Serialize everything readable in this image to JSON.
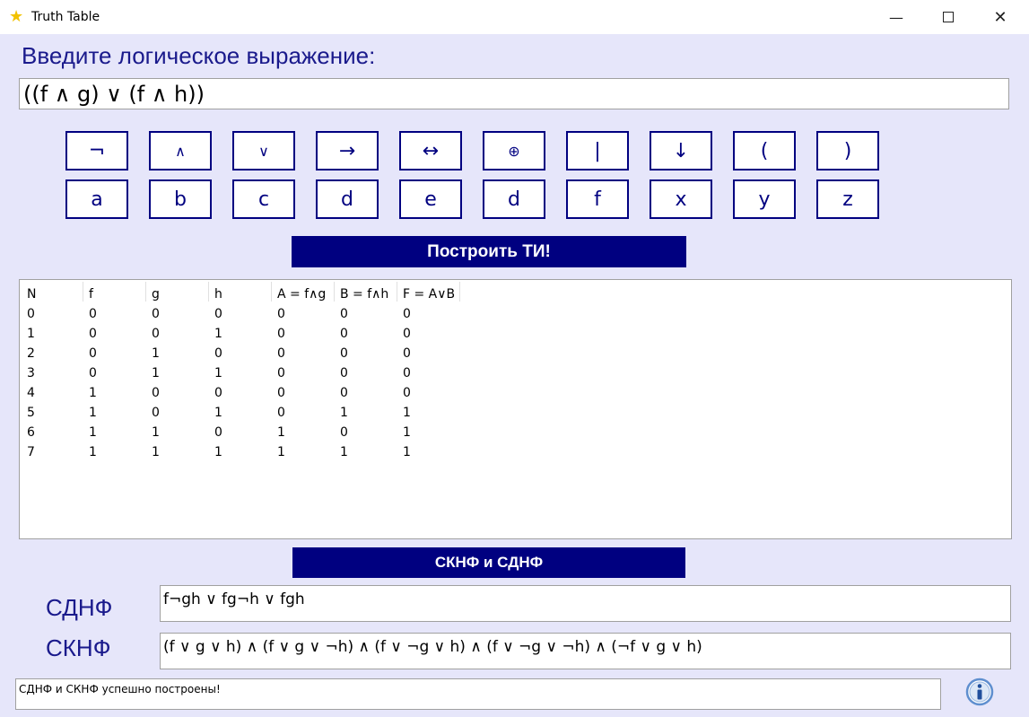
{
  "window": {
    "title": "Truth Table",
    "icon": "star-icon",
    "controls": {
      "minimize": "—",
      "close": "✕"
    }
  },
  "prompt": {
    "label": "Введите логическое выражение:"
  },
  "expression": {
    "value": "((f ∧ g) ∨ (f ∧ h))"
  },
  "keypad": {
    "operators": [
      "¬",
      "∧",
      "∨",
      "→",
      "↔",
      "⊕",
      "|",
      "↓",
      "(",
      ")"
    ],
    "variables": [
      "a",
      "b",
      "c",
      "d",
      "e",
      "d",
      "f",
      "x",
      "y",
      "z"
    ]
  },
  "build_button": {
    "label": "Построить ТИ!"
  },
  "truth_table": {
    "columns": [
      "N",
      "f",
      "g",
      "h",
      "A = f∧g",
      "B = f∧h",
      "F = A∨B"
    ],
    "rows": [
      [
        "0",
        "0",
        "0",
        "0",
        "0",
        "0",
        "0"
      ],
      [
        "1",
        "0",
        "0",
        "1",
        "0",
        "0",
        "0"
      ],
      [
        "2",
        "0",
        "1",
        "0",
        "0",
        "0",
        "0"
      ],
      [
        "3",
        "0",
        "1",
        "1",
        "0",
        "0",
        "0"
      ],
      [
        "4",
        "1",
        "0",
        "0",
        "0",
        "0",
        "0"
      ],
      [
        "5",
        "1",
        "0",
        "1",
        "0",
        "1",
        "1"
      ],
      [
        "6",
        "1",
        "1",
        "0",
        "1",
        "0",
        "1"
      ],
      [
        "7",
        "1",
        "1",
        "1",
        "1",
        "1",
        "1"
      ]
    ]
  },
  "forms_button": {
    "label": "СКНФ и СДНФ"
  },
  "sdnf": {
    "label": "СДНФ",
    "value": "f¬gh ∨ fg¬h ∨ fgh"
  },
  "sknf": {
    "label": "СКНФ",
    "value": "(f ∨ g ∨ h) ∧ (f ∨ g ∨ ¬h) ∧ (f ∨ ¬g ∨ h) ∧ (f ∨ ¬g ∨ ¬h) ∧ (¬f ∨ g ∨ h)"
  },
  "status": {
    "message": "СДНФ и СКНФ успешно построены!"
  },
  "info": {
    "icon": "info-icon"
  },
  "colors": {
    "accent": "#000080",
    "background": "#e6e6fa",
    "label_text": "#1a1a8c"
  }
}
